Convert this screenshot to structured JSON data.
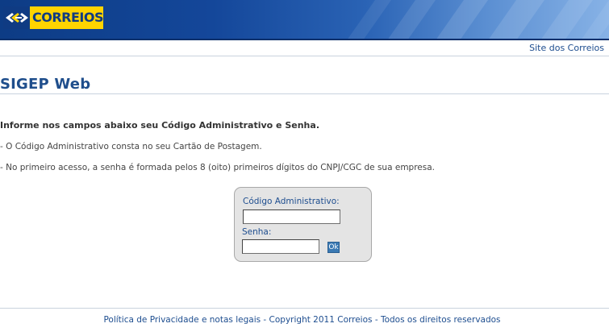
{
  "header": {
    "logo_text": "CORREIOS",
    "logo_icon": "correios-mark-icon",
    "colors": {
      "band_dark": "#0d3c85",
      "band_light": "#87b2e6",
      "logo_yellow": "#ffd400"
    }
  },
  "top_nav": {
    "site_link": "Site dos Correios"
  },
  "page": {
    "title": "SIGEP Web"
  },
  "instructions": {
    "heading": "Informe nos campos abaixo seu Código Administrativo e Senha.",
    "line1": "- O Código Administrativo consta no seu Cartão de Postagem.",
    "line2": "- No primeiro acesso, a senha é formada pelos 8 (oito) primeiros dígitos do CNPJ/CGC de sua empresa."
  },
  "login": {
    "code_label": "Código Administrativo:",
    "code_value": "",
    "password_label": "Senha:",
    "password_value": "",
    "submit_label": "Ok"
  },
  "footer": {
    "text": "Política de Privacidade e notas legais - Copyright 2011 Correios - Todos os direitos reservados"
  }
}
